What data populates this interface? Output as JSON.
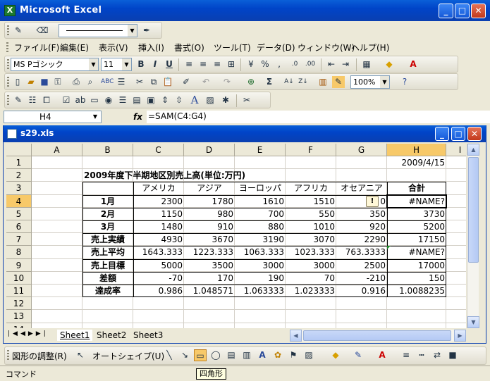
{
  "app": {
    "title": "Microsoft Excel"
  },
  "menu": [
    "ファイル(F)",
    "編集(E)",
    "表示(V)",
    "挿入(I)",
    "書式(O)",
    "ツール(T)",
    "データ(D)",
    "ウィンドウ(W)",
    "ヘルプ(H)"
  ],
  "format_toolbar": {
    "font": "MS Pゴシック",
    "size": "11"
  },
  "standard_toolbar": {
    "zoom": "100%"
  },
  "formula_bar": {
    "name_box": "H4",
    "fx": "fx",
    "formula": "=SAM(C4:G4)"
  },
  "workbook": {
    "title": "s29.xls"
  },
  "columns": [
    "A",
    "B",
    "C",
    "D",
    "E",
    "F",
    "G",
    "H",
    "I"
  ],
  "rows": [
    "1",
    "2",
    "3",
    "4",
    "5",
    "6",
    "7",
    "8",
    "9",
    "10",
    "11",
    "12",
    "13",
    "14"
  ],
  "sheet": {
    "date": "2009/4/15",
    "heading": "2009年度下半期地区別売上高(単位:万円)",
    "header": [
      "アメリカ",
      "アジア",
      "ヨーロッパ",
      "アフリカ",
      "オセアニア",
      "合計"
    ],
    "data_rows": [
      {
        "label": "1月",
        "values": [
          "2300",
          "1780",
          "1610",
          "1510",
          "0",
          "#NAME?"
        ]
      },
      {
        "label": "2月",
        "values": [
          "1150",
          "980",
          "700",
          "550",
          "350",
          "3730"
        ]
      },
      {
        "label": "3月",
        "values": [
          "1480",
          "910",
          "880",
          "1010",
          "920",
          "5200"
        ]
      },
      {
        "label": "売上実績",
        "values": [
          "4930",
          "3670",
          "3190",
          "3070",
          "2290",
          "17150"
        ]
      },
      {
        "label": "売上平均",
        "values": [
          "1643.333",
          "1223.333",
          "1063.333",
          "1023.333",
          "763.3333",
          "#NAME?"
        ]
      },
      {
        "label": "売上目標",
        "values": [
          "5000",
          "3500",
          "3000",
          "3000",
          "2500",
          "17000"
        ]
      },
      {
        "label": "差額",
        "values": [
          "-70",
          "170",
          "190",
          "70",
          "-210",
          "150"
        ]
      },
      {
        "label": "達成率",
        "values": [
          "0.986",
          "1.048571",
          "1.063333",
          "1.023333",
          "0.916",
          "1.0088235"
        ]
      }
    ]
  },
  "sheet_tabs": [
    "Sheet1",
    "Sheet2",
    "Sheet3"
  ],
  "drawing_toolbar": {
    "draw_label": "図形の調整(R)",
    "autoshape_label": "オートシェイプ(U)"
  },
  "status": {
    "text": "コマンド",
    "tooltip": "四角形"
  }
}
